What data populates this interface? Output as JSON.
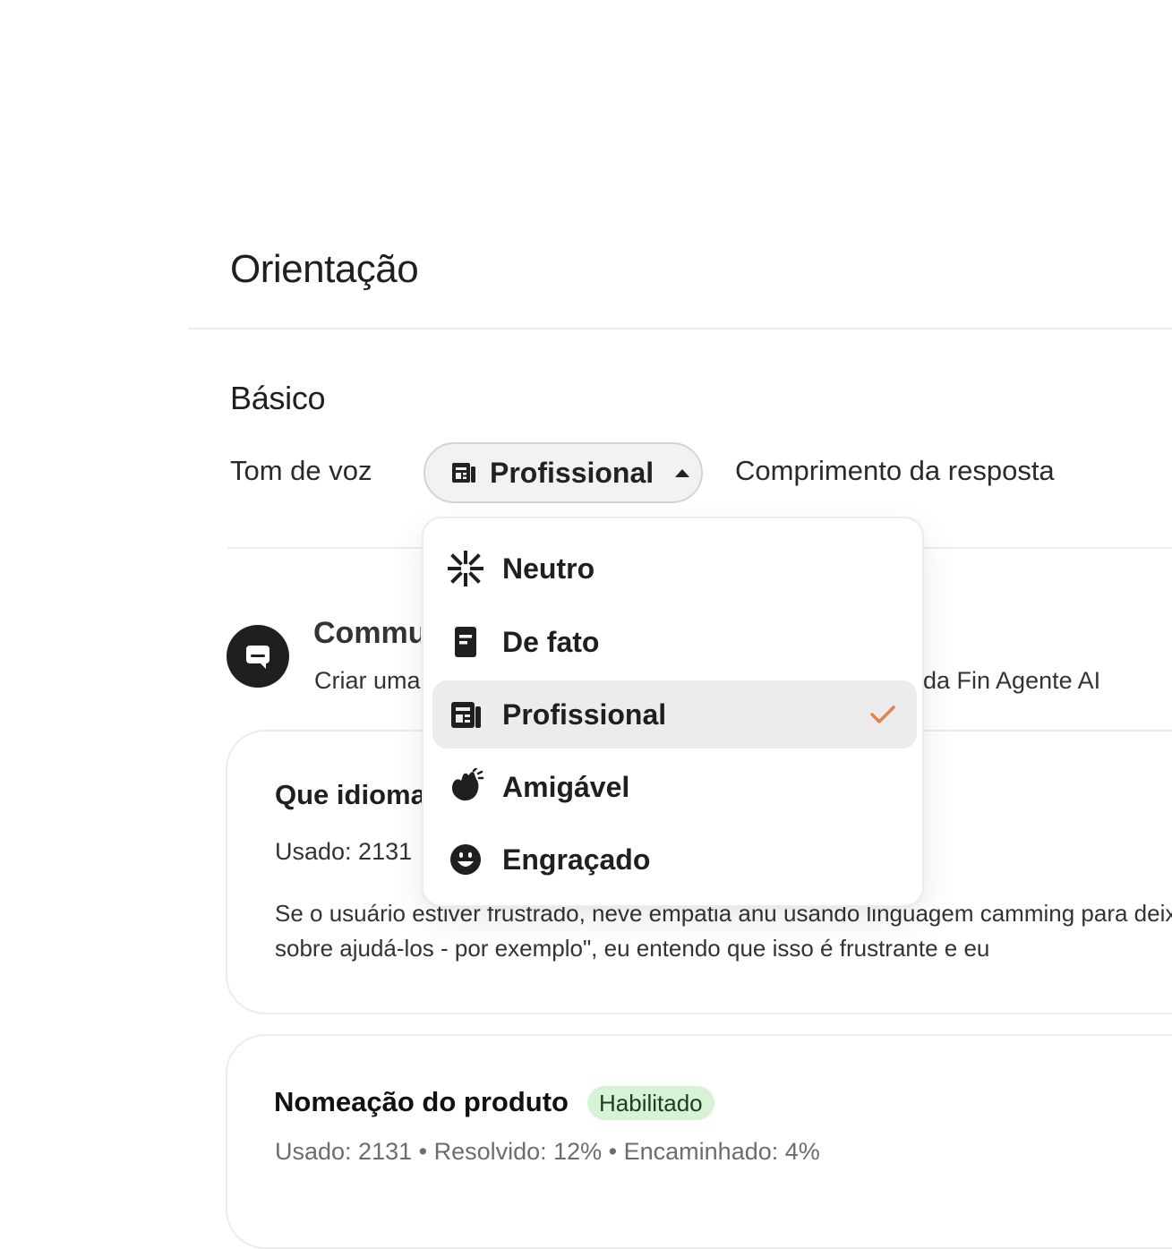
{
  "page": {
    "title": "Orientação"
  },
  "section": {
    "title": "Básico"
  },
  "tone": {
    "label": "Tom de voz",
    "selected": "Profissional",
    "selected_icon": "newspaper-icon"
  },
  "length": {
    "label": "Comprimento da resposta"
  },
  "dropdown": {
    "items": [
      {
        "label": "Neutro",
        "icon": "burst-icon",
        "selected": false
      },
      {
        "label": "De fato",
        "icon": "document-icon",
        "selected": false
      },
      {
        "label": "Profissional",
        "icon": "newspaper-icon",
        "selected": true
      },
      {
        "label": "Amigável",
        "icon": "waving-hand-icon",
        "selected": false
      },
      {
        "label": "Engraçado",
        "icon": "grinning-face-icon",
        "selected": false
      }
    ],
    "check_color": "#e8804a"
  },
  "communication": {
    "title_visible": "Commu",
    "desc_left_visible": "Criar uma",
    "desc_right_visible": "da Fin Agente AI"
  },
  "card1": {
    "title_visible": "Que idioma",
    "used": "Usado: 2131",
    "body_line1": "Se o usuário estiver frustrado, neve empatia anu usando linguagem camming para deix",
    "body_line2": "sobre ajudá-los - por exemplo\", eu entendo que isso é frustrante e eu"
  },
  "card2": {
    "title": "Nomeação do produto",
    "badge": "Habilitado",
    "meta": "Usado: 2131 • Resolvido: 12% • Encaminhado: 4%"
  },
  "colors": {
    "badge_bg": "#d7f2d4",
    "avatar_bg": "#1f1f1f"
  }
}
